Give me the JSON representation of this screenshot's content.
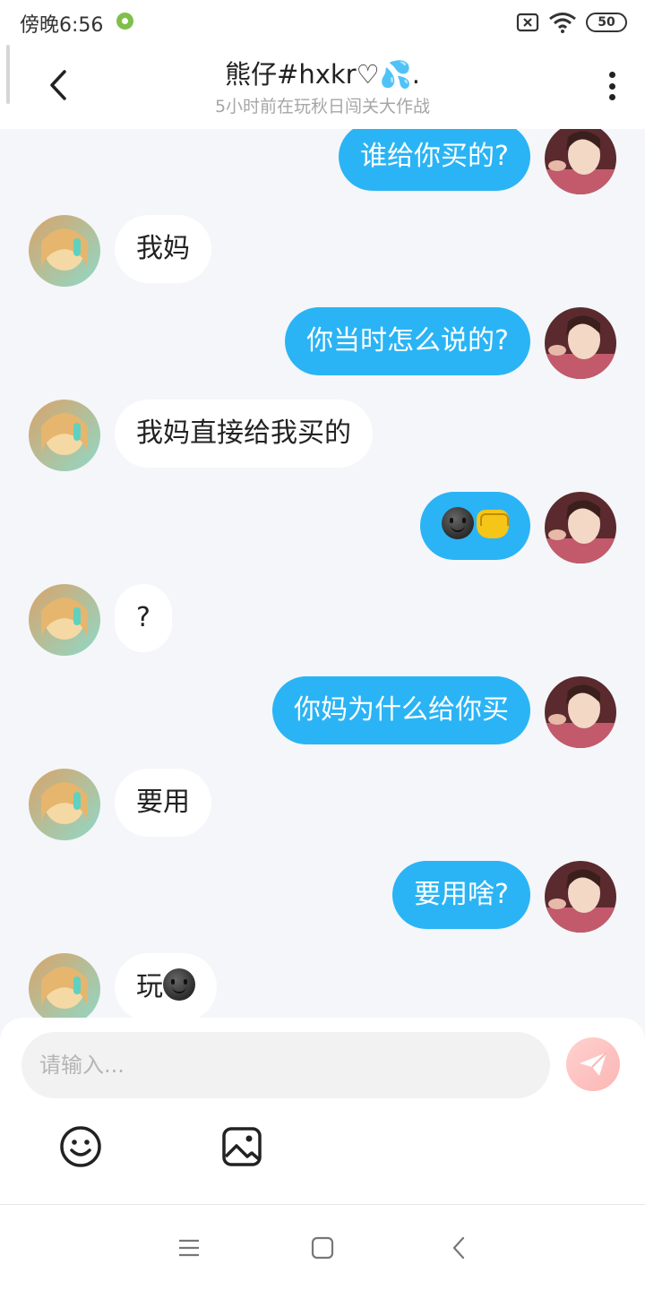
{
  "status_bar": {
    "time": "傍晚6:56",
    "battery": "50",
    "icons": [
      "app-notification-icon",
      "sim-off-icon",
      "wifi-icon",
      "battery-icon"
    ]
  },
  "header": {
    "title": "熊仔#hxkr♡💦.",
    "subtitle": "5小时前在玩秋日闯关大作战",
    "icons": [
      "back-arrow-icon",
      "more-vertical-icon"
    ]
  },
  "messages": [
    {
      "side": "out",
      "text": "谁给你买的?"
    },
    {
      "side": "in",
      "text": "我妈"
    },
    {
      "side": "out",
      "text": "你当时怎么说的?"
    },
    {
      "side": "in",
      "text": "我妈直接给我买的"
    },
    {
      "side": "out",
      "text": "",
      "emojis": [
        "dark-smiley-emoji",
        "fist-emoji"
      ]
    },
    {
      "side": "in",
      "text": "?"
    },
    {
      "side": "out",
      "text": "你妈为什么给你买"
    },
    {
      "side": "in",
      "text": "要用"
    },
    {
      "side": "out",
      "text": "要用啥?"
    },
    {
      "side": "in",
      "text": "玩",
      "emojis": [
        "dark-smiley-emoji"
      ]
    }
  ],
  "composer": {
    "placeholder": "请输入...",
    "icons": [
      "send-icon",
      "emoji-icon",
      "image-icon"
    ]
  },
  "nav_bar": {
    "icons": [
      "menu-icon",
      "home-icon",
      "back-icon"
    ]
  },
  "colors": {
    "outgoing_bubble": "#2ab4f5",
    "incoming_bubble": "#ffffff",
    "background": "#f4f6f9",
    "send_button": "#fbb6b4"
  }
}
